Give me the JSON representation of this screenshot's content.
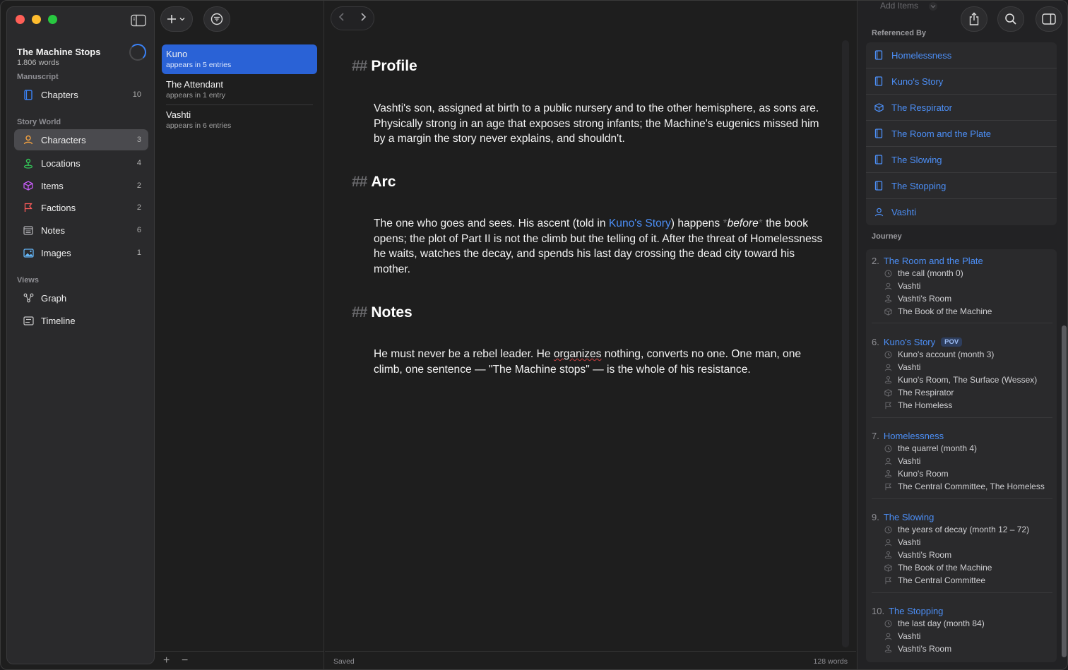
{
  "sidebar": {
    "project_title": "The Machine Stops",
    "project_words": "1.806 words",
    "sections": {
      "manuscript": "Manuscript",
      "story_world": "Story World",
      "views": "Views"
    },
    "items": [
      {
        "label": "Chapters",
        "count": "10",
        "icon": "book-icon",
        "color": "#3a82f7"
      },
      {
        "label": "Characters",
        "count": "3",
        "icon": "person-icon",
        "color": "#f0a040"
      },
      {
        "label": "Locations",
        "count": "4",
        "icon": "pin-icon",
        "color": "#34c759"
      },
      {
        "label": "Items",
        "count": "2",
        "icon": "cube-icon",
        "color": "#c45bf5"
      },
      {
        "label": "Factions",
        "count": "2",
        "icon": "flag-icon",
        "color": "#ff5b5b"
      },
      {
        "label": "Notes",
        "count": "6",
        "icon": "notes-icon",
        "color": "#aeaeb2"
      },
      {
        "label": "Images",
        "count": "1",
        "icon": "image-icon",
        "color": "#64b5f6"
      }
    ],
    "views": [
      {
        "label": "Graph",
        "icon": "graph-icon"
      },
      {
        "label": "Timeline",
        "icon": "timeline-icon"
      }
    ]
  },
  "list": {
    "items": [
      {
        "name": "Kuno",
        "sub": "appears in 5 entries"
      },
      {
        "name": "The Attendant",
        "sub": "appears in 1 entry"
      },
      {
        "name": "Vashti",
        "sub": "appears in 6 entries"
      }
    ],
    "footer_add": "+",
    "footer_remove": "−"
  },
  "editor": {
    "hash": "##",
    "profile_heading": "Profile",
    "profile_text": "Vashti's son, assigned at birth to a public nursery and to the other hemisphere, as sons are. Physically strong in an age that exposes strong infants; the Machine's eugenics missed him by a margin the story never explains, and shouldn't.",
    "arc_heading": "Arc",
    "arc_text_1": "The one who goes and sees. His ascent (told in ",
    "arc_link": "Kuno's Story",
    "arc_text_2": ") happens ",
    "arc_mark": "*",
    "arc_italic": "before",
    "arc_text_3": " the book opens; the plot of Part II is not the climb but the telling of it. After the threat of Homelessness he waits, watches the decay, and spends his last day crossing the dead city toward his mother.",
    "notes_heading": "Notes",
    "notes_text_1": "He must never be a rebel leader. He ",
    "notes_spell": "organizes",
    "notes_text_2": " nothing, converts no one. One man, one climb, one sentence — \"The Machine stops\" — is the whole of his resistance.",
    "footer_status": "Saved",
    "footer_words": "128 words"
  },
  "inspector": {
    "add_items": "Add Items",
    "referenced_by_label": "Referenced By",
    "referenced_by": [
      {
        "label": "Homelessness",
        "icon": "book-icon"
      },
      {
        "label": "Kuno's Story",
        "icon": "book-icon"
      },
      {
        "label": "The Respirator",
        "icon": "cube-icon"
      },
      {
        "label": "The Room and the Plate",
        "icon": "book-icon"
      },
      {
        "label": "The Slowing",
        "icon": "book-icon"
      },
      {
        "label": "The Stopping",
        "icon": "book-icon"
      },
      {
        "label": "Vashti",
        "icon": "person-icon"
      }
    ],
    "journey_label": "Journey",
    "pov_badge": "POV",
    "journey": [
      {
        "num": "2.",
        "title": "The Room and the Plate",
        "lines": [
          {
            "icon": "clock-icon",
            "text": "the call (month 0)"
          },
          {
            "icon": "person-icon",
            "text": "Vashti"
          },
          {
            "icon": "pin-icon",
            "text": "Vashti's Room"
          },
          {
            "icon": "cube-icon",
            "text": "The Book of the Machine"
          }
        ]
      },
      {
        "num": "6.",
        "title": "Kuno's Story",
        "lines": [
          {
            "icon": "clock-icon",
            "text": "Kuno's account (month 3)"
          },
          {
            "icon": "person-icon",
            "text": "Vashti"
          },
          {
            "icon": "pin-icon",
            "text": "Kuno's Room, The Surface (Wessex)"
          },
          {
            "icon": "cube-icon",
            "text": "The Respirator"
          },
          {
            "icon": "flag-icon",
            "text": "The Homeless"
          }
        ]
      },
      {
        "num": "7.",
        "title": "Homelessness",
        "lines": [
          {
            "icon": "clock-icon",
            "text": "the quarrel (month 4)"
          },
          {
            "icon": "person-icon",
            "text": "Vashti"
          },
          {
            "icon": "pin-icon",
            "text": "Kuno's Room"
          },
          {
            "icon": "flag-icon",
            "text": "The Central Committee, The Homeless"
          }
        ]
      },
      {
        "num": "9.",
        "title": "The Slowing",
        "lines": [
          {
            "icon": "clock-icon",
            "text": "the years of decay (month 12 – 72)"
          },
          {
            "icon": "person-icon",
            "text": "Vashti"
          },
          {
            "icon": "pin-icon",
            "text": "Vashti's Room"
          },
          {
            "icon": "cube-icon",
            "text": "The Book of the Machine"
          },
          {
            "icon": "flag-icon",
            "text": "The Central Committee"
          }
        ]
      },
      {
        "num": "10.",
        "title": "The Stopping",
        "lines": [
          {
            "icon": "clock-icon",
            "text": "the last day (month 84)"
          },
          {
            "icon": "person-icon",
            "text": "Vashti"
          },
          {
            "icon": "pin-icon",
            "text": "Vashti's Room"
          }
        ]
      }
    ]
  }
}
